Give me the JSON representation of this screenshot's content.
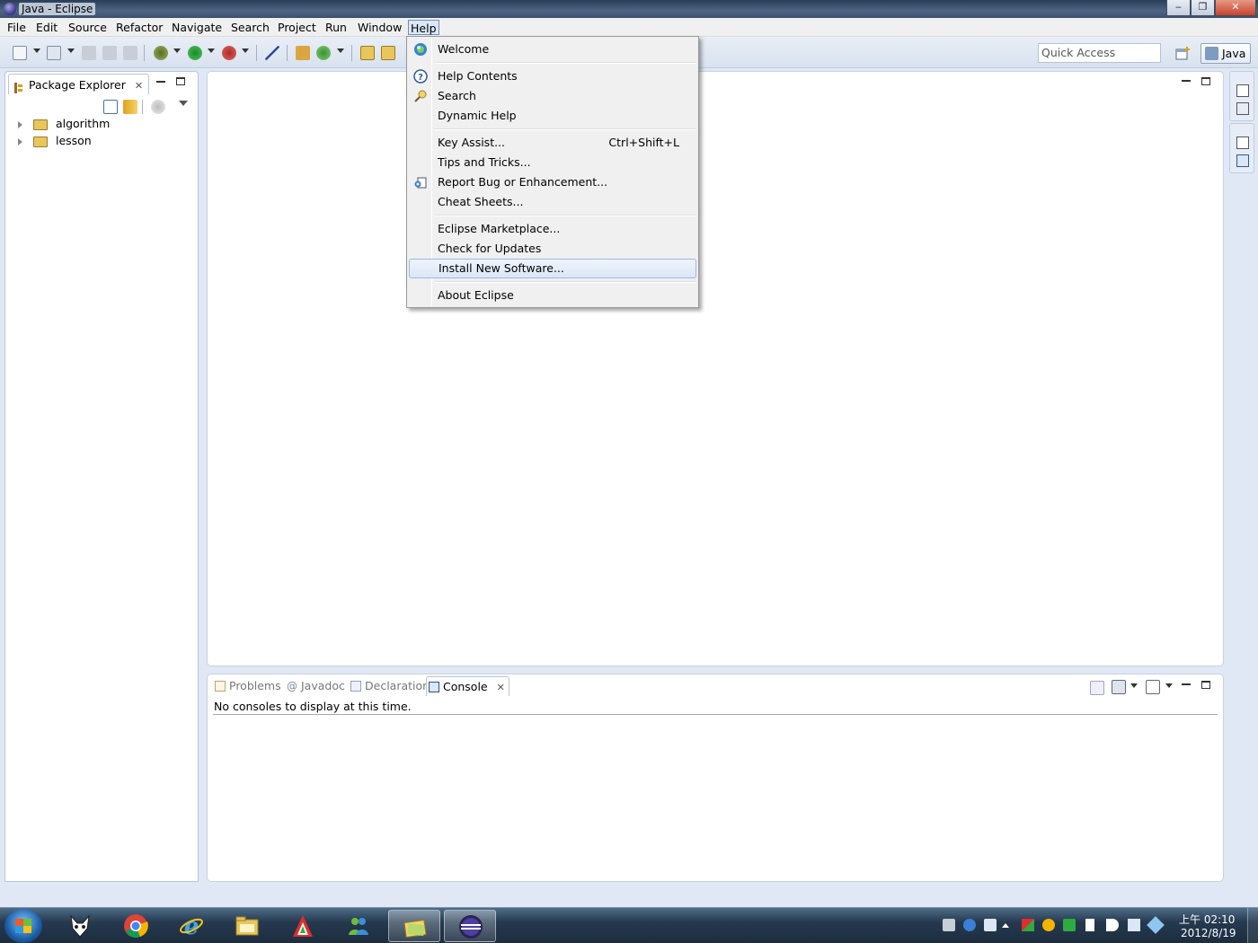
{
  "window": {
    "title": "Java - Eclipse",
    "minimize_label": "‒",
    "maximize_label": "❐",
    "close_label": "✕"
  },
  "menubar": {
    "items": [
      "File",
      "Edit",
      "Source",
      "Refactor",
      "Navigate",
      "Search",
      "Project",
      "Run",
      "Window",
      "Help"
    ],
    "open_menu": "Help"
  },
  "toolbar": {
    "quick_access_placeholder": "Quick Access",
    "perspective_label": "Java"
  },
  "package_explorer": {
    "tab_label": "Package Explorer",
    "close_glyph": "✕",
    "projects": [
      "algorithm",
      "lesson"
    ]
  },
  "help_menu": {
    "items": [
      {
        "label": "Welcome",
        "icon": "welcome-icon"
      },
      {
        "label": "Help Contents",
        "icon": "help-contents-icon"
      },
      {
        "label": "Search",
        "icon": "help-search-icon"
      },
      {
        "label": "Dynamic Help"
      },
      {
        "label": "Key Assist...",
        "shortcut": "Ctrl+Shift+L"
      },
      {
        "label": "Tips and Tricks..."
      },
      {
        "label": "Report Bug or Enhancement...",
        "icon": "report-bug-icon"
      },
      {
        "label": "Cheat Sheets..."
      },
      {
        "label": "Eclipse Marketplace..."
      },
      {
        "label": "Check for Updates"
      },
      {
        "label": "Install New Software...",
        "highlighted": true
      },
      {
        "label": "About Eclipse"
      }
    ]
  },
  "bottom_panel": {
    "tabs": [
      {
        "label": "Problems",
        "active": false
      },
      {
        "label": "Javadoc",
        "active": false
      },
      {
        "label": "Declaration",
        "active": false
      },
      {
        "label": "Console",
        "active": true
      }
    ],
    "close_glyph": "✕",
    "console_message": "No consoles to display at this time."
  },
  "taskbar": {
    "apps": [
      "explorer-fox-icon",
      "chrome-icon",
      "internet-explorer-icon",
      "file-explorer-icon",
      "adobe-icon",
      "messenger-icon",
      "windows-folder-icon",
      "eclipse-icon"
    ],
    "clock_time": "上午 02:10",
    "clock_date": "2012/8/19"
  },
  "colors": {
    "menu_highlight": "#dbe7f7",
    "toolbar_bg": "#dfe8f4",
    "taskbar_bg": "#25394f"
  }
}
